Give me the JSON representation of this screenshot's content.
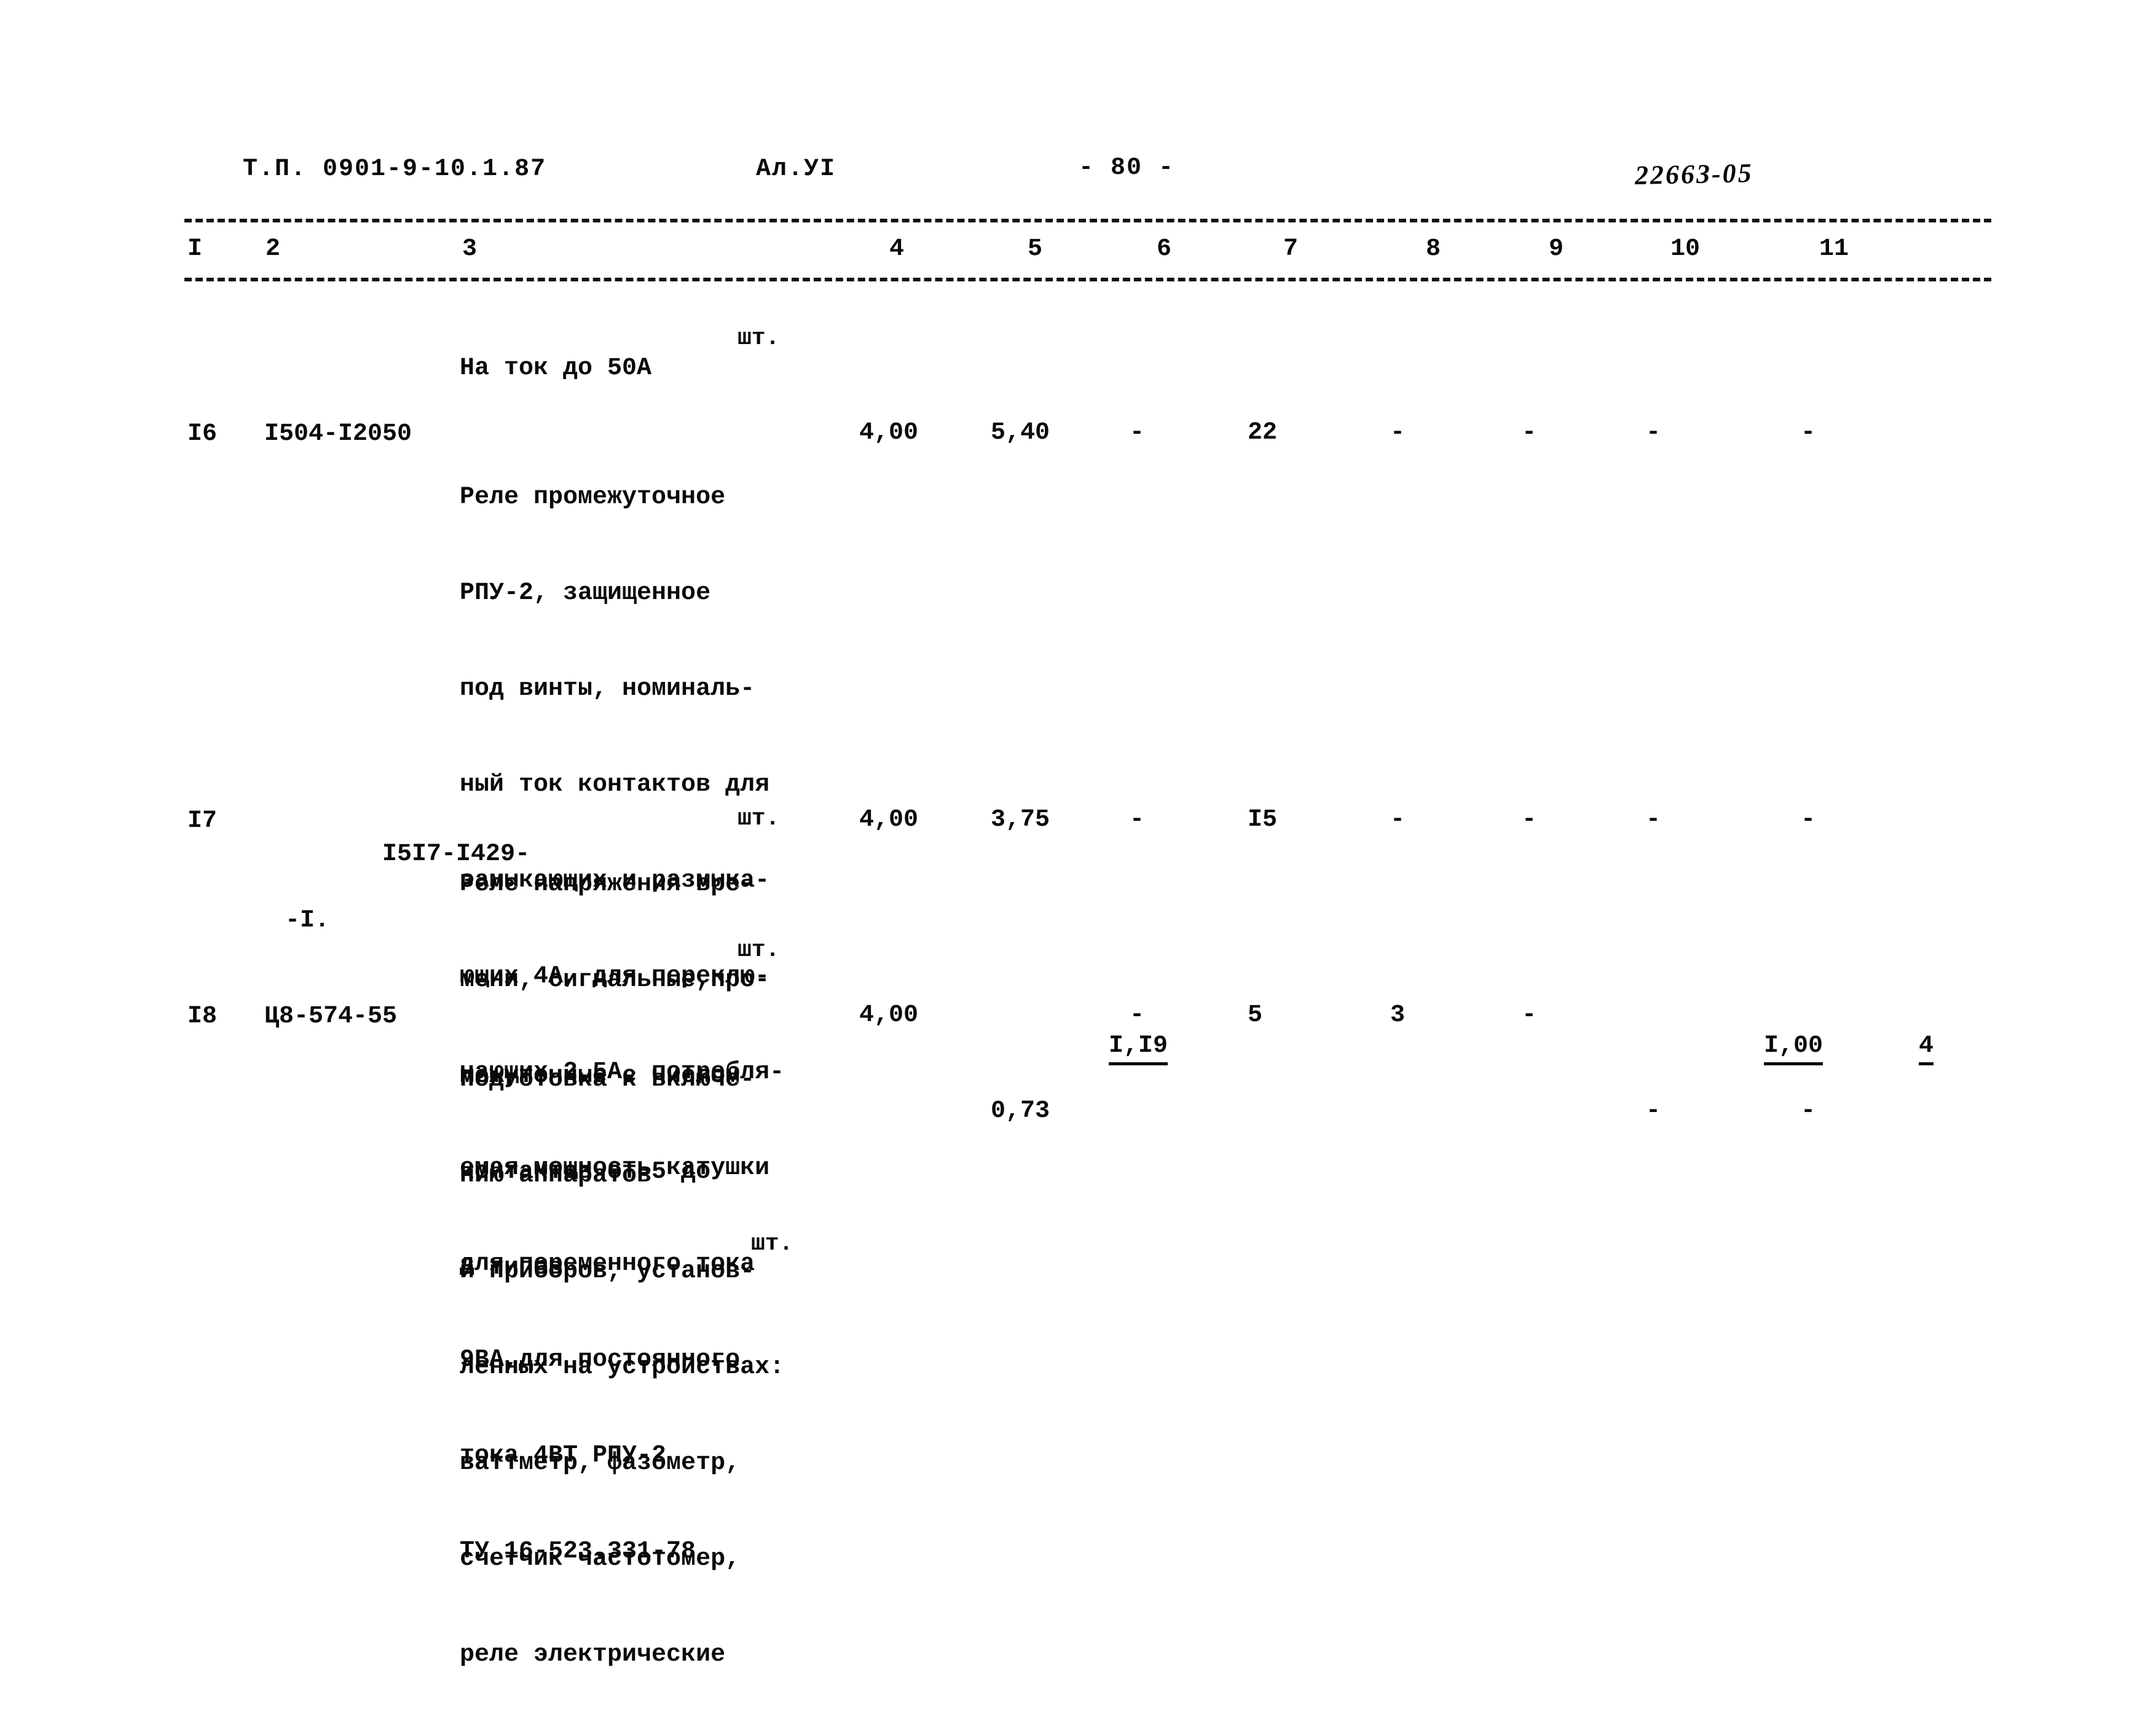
{
  "header": {
    "doc_code": "Т.П. 0901-9-10.1.87",
    "album": "Ал.УI",
    "page_number": "- 80 -",
    "archive_stamp": "22663-05"
  },
  "table": {
    "column_numbers": [
      "I",
      "2",
      "3",
      "4",
      "5",
      "6",
      "7",
      "8",
      "9",
      "10",
      "11"
    ],
    "continuation_row": {
      "description": [
        "На ток до 50А"
      ],
      "unit": "шт."
    },
    "rows": [
      {
        "num": "I6",
        "code": "I504-I2050",
        "code_line2": "",
        "description": [
          "Реле промежуточное",
          "РПУ-2, защищенное",
          "под винты, номиналь-",
          "ный ток контактов для",
          "замыкающих и размыка-",
          "ющих 4А, для переклю-",
          "чающих 2,5А, потребля-",
          "емая мощность катушки",
          "для переменного тока",
          "9ВА,для постоянного",
          "тока 4ВТ РПУ-2",
          "ТУ 16-523.331-78"
        ],
        "unit": "шт.",
        "c4": "4,00",
        "c5": "5,40",
        "c5_sub": "",
        "c5_underline": false,
        "c6": "-",
        "c7": "22",
        "c8": "-",
        "c9": "-",
        "c10": "-",
        "c10_sub": "",
        "c10_underline": false,
        "c11": "-",
        "c11_sub": "",
        "c11_underline": false
      },
      {
        "num": "I7",
        "code": "I5I7-I429-",
        "code_line2": "-I.",
        "description": [
          "Реле напряжения вре-",
          "мени, сигнальные,про-",
          "межуточные с числом",
          "контактов от 5 до",
          "8 типов"
        ],
        "unit": "шт.",
        "c4": "4,00",
        "c5": "3,75",
        "c5_sub": "",
        "c5_underline": false,
        "c6": "-",
        "c7": "I5",
        "c8": "-",
        "c9": "-",
        "c10": "-",
        "c10_sub": "",
        "c10_underline": false,
        "c11": "-",
        "c11_sub": "",
        "c11_underline": false
      },
      {
        "num": "I8",
        "code": "Ц8-574-55",
        "code_line2": "",
        "description": [
          "Подготовка к включе-",
          "нию аппаратов",
          "и приборов, установ-",
          "ленных на устройствах:",
          "ваттметр, фазометр,",
          "счетчик частотомер,",
          "реле электрические"
        ],
        "unit": "шт.",
        "c4": "4,00",
        "c5": "I,I9",
        "c5_sub": "0,73",
        "c5_underline": true,
        "c6": "-",
        "c7": "5",
        "c8": "3",
        "c9": "-",
        "c10": "I,00",
        "c10_sub": "-",
        "c10_underline": true,
        "c11": "4",
        "c11_sub": "-",
        "c11_underline": true
      }
    ]
  }
}
